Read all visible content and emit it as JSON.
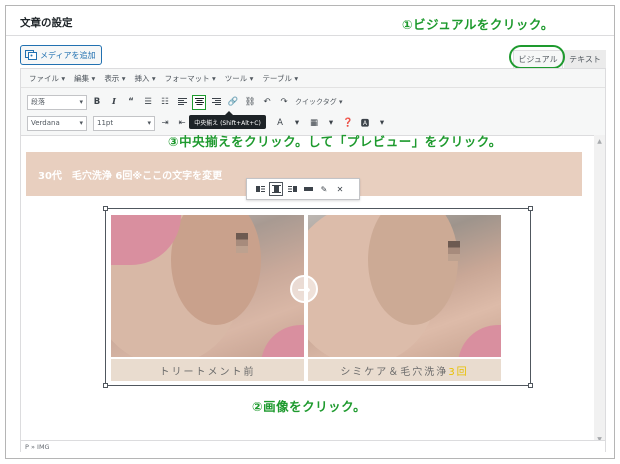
{
  "header": {
    "title": "文章の設定"
  },
  "instructions": {
    "step1": "①ビジュアルをクリック。",
    "step2": "②画像をクリック。",
    "step3": "③中央揃えをクリック。して「プレビュー」をクリック。"
  },
  "media_button": {
    "label": "メディアを追加"
  },
  "tabs": {
    "visual": "ビジュアル",
    "text": "テキスト",
    "active": "visual"
  },
  "menubar": [
    "ファイル ▾",
    "編集 ▾",
    "表示 ▾",
    "挿入 ▾",
    "フォーマット ▾",
    "ツール ▾",
    "テーブル ▾"
  ],
  "toolbar1": {
    "format_select": "段落",
    "bold": "B",
    "italic": "I",
    "quote": "“",
    "quick_tag": "クイックタグ ▾"
  },
  "toolbar2": {
    "font_select": "Verdana",
    "size_select": "11pt",
    "text_color": "A"
  },
  "tooltip": {
    "text": "中央揃え (Shift+Alt+C)"
  },
  "content": {
    "banner_text": "30代　毛穴洗浄 6回※ここの文字を変更",
    "caption_before": "トリートメント前",
    "caption_after_main": "シミケア＆毛穴洗浄",
    "caption_after_accent": "3回"
  },
  "statusbar": {
    "path": "P » IMG"
  },
  "colors": {
    "accent_green": "#1e9a2e",
    "banner": "#e8cfbf",
    "link_blue": "#2271b1"
  }
}
